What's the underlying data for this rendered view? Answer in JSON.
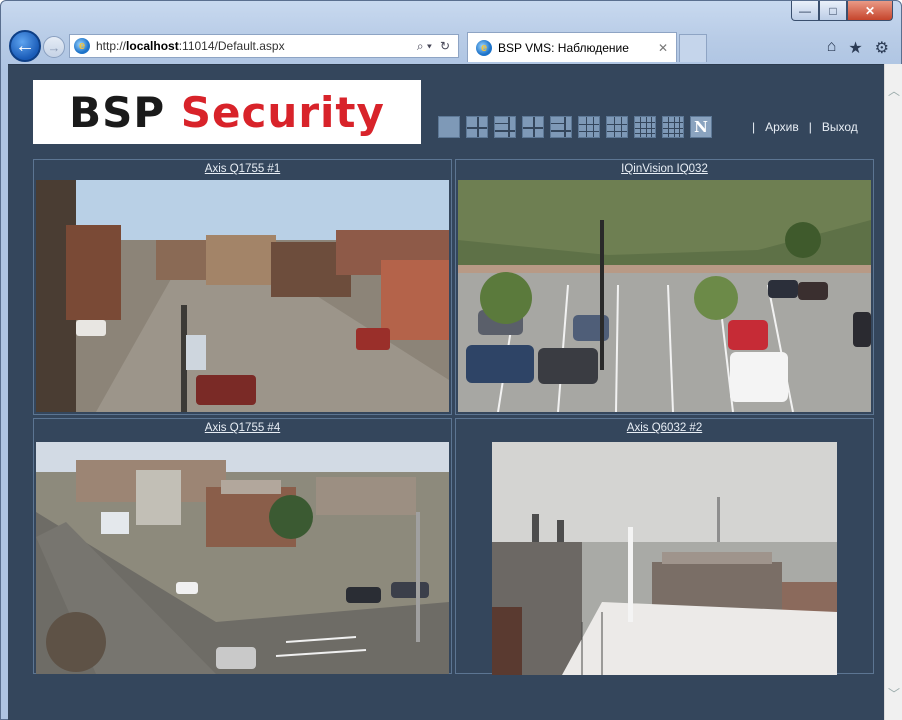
{
  "browser": {
    "url_prefix": "http://",
    "url_host": "localhost",
    "url_rest": ":11014/Default.aspx",
    "tab_title": "BSP VMS: Наблюдение",
    "search_glyph": "⌕ ▾",
    "refresh_glyph": "↻",
    "window_controls": {
      "minimize": "—",
      "maximize": "□",
      "close": "✕"
    }
  },
  "app": {
    "logo_part1": "BSP ",
    "logo_part2": "Security",
    "layout_buttons": [
      "1x1",
      "2x2",
      "1+5",
      "2x2",
      "1+7",
      "3x3",
      "1+12",
      "4x4",
      "4x4",
      "N"
    ],
    "n_label": "N",
    "links": {
      "separator": "|",
      "archive": "Архив",
      "exit": "Выход"
    }
  },
  "cameras": [
    {
      "title": "Axis Q1755 #1",
      "scene": "street-downtown"
    },
    {
      "title": "IQinVision IQ032",
      "scene": "parking-lot"
    },
    {
      "title": "Axis Q1755 #4",
      "scene": "town-intersection"
    },
    {
      "title": "Axis Q6032 #2",
      "scene": "snowy-rooftop"
    }
  ],
  "colors": {
    "content_bg": "#34465c",
    "logo_red": "#d8232a",
    "link_text": "#e8eef5"
  }
}
